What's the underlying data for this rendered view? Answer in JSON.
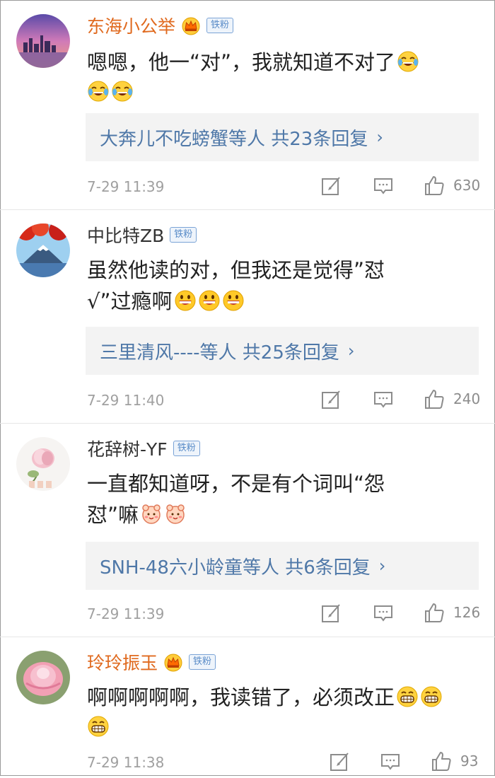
{
  "comments": [
    {
      "name": "东海小公举",
      "vip": true,
      "badge": "铁粉",
      "text_line1": "嗯嗯，他一“对”，我就知道不对了",
      "text_line2": "",
      "emoji_after_line1": [
        "laughing-tears"
      ],
      "emoji_line2": [
        "laughing-tears",
        "laughing-tears"
      ],
      "replies": "大奔儿不吃螃蟹等人 共23条回复",
      "time": "7-29 11:39",
      "likes": "630"
    },
    {
      "name": "中比特ZB",
      "vip": false,
      "badge": "铁粉",
      "text_line1": "虽然他读的对，但我还是觉得”怼",
      "text_line2": "√”过瘾啊",
      "emoji_line2": [
        "grin",
        "grin",
        "grin"
      ],
      "replies": "三里清风----等人 共25条回复",
      "time": "7-29 11:40",
      "likes": "240"
    },
    {
      "name": "花辞树-YF",
      "vip": false,
      "badge": "铁粉",
      "text_line1": "一直都知道呀，不是有个词叫“怨",
      "text_line2": "怼”嘛",
      "emoji_line2": [
        "cute-face",
        "cute-face"
      ],
      "replies": "SNH-48六小龄童等人 共6条回复",
      "time": "7-29 11:39",
      "likes": "126"
    },
    {
      "name": "玲玲振玉",
      "vip": true,
      "badge": "铁粉",
      "text_line1": "啊啊啊啊啊，我读错了，必须改正",
      "emoji_after_line1": [
        "big-grin",
        "big-grin"
      ],
      "emoji_line2": [
        "big-grin"
      ],
      "replies": "",
      "time": "7-29 11:38",
      "likes": "93"
    }
  ],
  "colors": {
    "vip_name": "#e06a1f",
    "reply_link": "#4f78a8",
    "badge": "#5a8cc8",
    "meta": "#a0a0a0"
  },
  "icons": [
    "crown-icon",
    "repost-icon",
    "comment-icon",
    "like-icon",
    "chevron-right-icon"
  ]
}
